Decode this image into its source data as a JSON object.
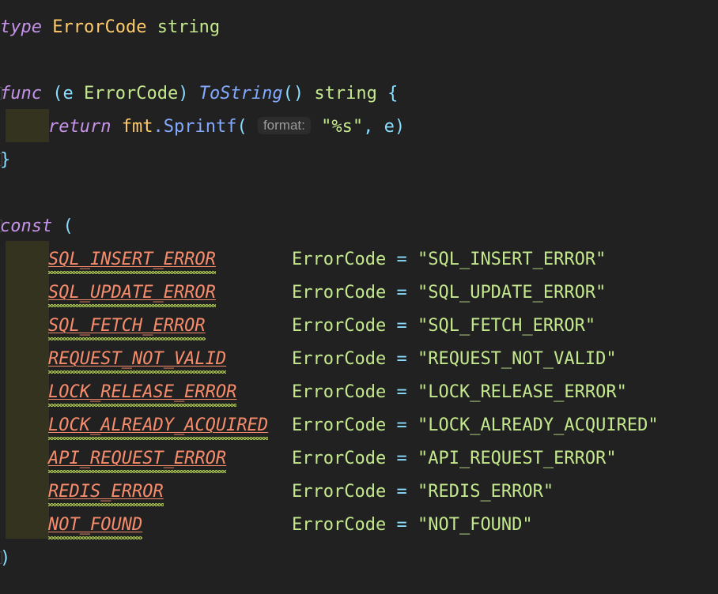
{
  "editor": {
    "language": "go",
    "background_color": "#212121",
    "indent_guide_color": "#33331f",
    "colors": {
      "keyword": "#c792ea",
      "type_name": "#ffcb6b",
      "string": "#c3e88d",
      "identifier_green": "#c3e88d",
      "punctuation": "#89ddff",
      "function": "#82aaff",
      "constant": "#f78c6c",
      "spellcheck_squiggle": "#b5cf5b",
      "inlay_hint_text": "#9b9b9b",
      "inlay_hint_background": "#2c2c2c"
    }
  },
  "code": {
    "type_decl": {
      "keyword": "type",
      "name": "ErrorCode",
      "underlying": "string"
    },
    "method": {
      "keyword": "func",
      "receiver_open": "(",
      "receiver_name": "e",
      "receiver_type": "ErrorCode",
      "receiver_close": ")",
      "name": "ToString",
      "params": "()",
      "return_type": "string",
      "brace_open": "{",
      "brace_close": "}",
      "body": {
        "keyword": "return",
        "package": "fmt",
        "dot": ".",
        "function": "Sprintf",
        "paren_open": "(",
        "inlay_hint": "format:",
        "format_string": "\"%s\"",
        "comma": ",",
        "arg": "e",
        "paren_close": ")"
      }
    },
    "const_block": {
      "keyword": "const",
      "paren_open": "(",
      "paren_close": ")",
      "type_name": "ErrorCode",
      "equals": "=",
      "entries": [
        {
          "name": "SQL_INSERT_ERROR",
          "type": "ErrorCode",
          "value": "\"SQL_INSERT_ERROR\""
        },
        {
          "name": "SQL_UPDATE_ERROR",
          "type": "ErrorCode",
          "value": "\"SQL_UPDATE_ERROR\""
        },
        {
          "name": "SQL_FETCH_ERROR",
          "type": "ErrorCode",
          "value": "\"SQL_FETCH_ERROR\""
        },
        {
          "name": "REQUEST_NOT_VALID",
          "type": "ErrorCode",
          "value": "\"REQUEST_NOT_VALID\""
        },
        {
          "name": "LOCK_RELEASE_ERROR",
          "type": "ErrorCode",
          "value": "\"LOCK_RELEASE_ERROR\""
        },
        {
          "name": "LOCK_ALREADY_ACQUIRED",
          "type": "ErrorCode",
          "value": "\"LOCK_ALREADY_ACQUIRED\""
        },
        {
          "name": "API_REQUEST_ERROR",
          "type": "ErrorCode",
          "value": "\"API_REQUEST_ERROR\""
        },
        {
          "name": "REDIS_ERROR",
          "type": "ErrorCode",
          "value": "\"REDIS_ERROR\""
        },
        {
          "name": "NOT_FOUND",
          "type": "ErrorCode",
          "value": "\"NOT_FOUND\""
        }
      ]
    }
  }
}
